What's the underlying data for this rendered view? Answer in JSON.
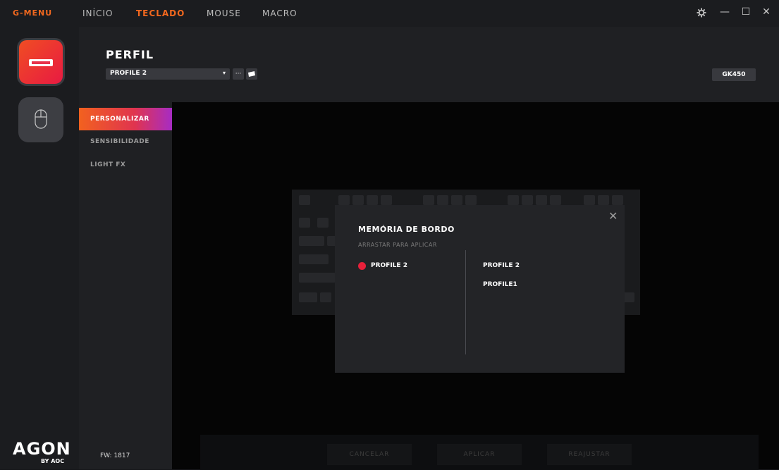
{
  "app": {
    "logo": "G-MENU"
  },
  "nav": [
    {
      "label": "INÍCIO"
    },
    {
      "label": "TECLADO"
    },
    {
      "label": "MOUSE"
    },
    {
      "label": "MACRO"
    }
  ],
  "window": {
    "settings_icon": "gear-icon",
    "min_glyph": "—",
    "max_glyph": "☐",
    "close_glyph": "✕"
  },
  "brand": {
    "name": "AGON",
    "sub": "BY AOC"
  },
  "header": {
    "title": "PERFIL",
    "profile_select": "PROFILE 2",
    "caret": "▾",
    "more": "···",
    "model": "GK450"
  },
  "subnav": [
    {
      "label": "PERSONALIZAR"
    },
    {
      "label": "SENSIBILIDADE"
    },
    {
      "label": "LIGHT FX"
    }
  ],
  "firmware": "FW: 1817",
  "bottom_buttons": [
    {
      "label": "CANCELAR"
    },
    {
      "label": "APLICAR"
    },
    {
      "label": "REAJUSTAR"
    }
  ],
  "modal": {
    "title": "MEMÓRIA DE BORDO",
    "subtitle": "ARRASTAR PARA APLICAR",
    "active_slot": "PROFILE 2",
    "profiles": [
      "PROFILE 2",
      "PROFILE1"
    ],
    "close_glyph": "✕",
    "colors": {
      "active_dot": "#e8203a",
      "accent": "#f2681f"
    }
  }
}
